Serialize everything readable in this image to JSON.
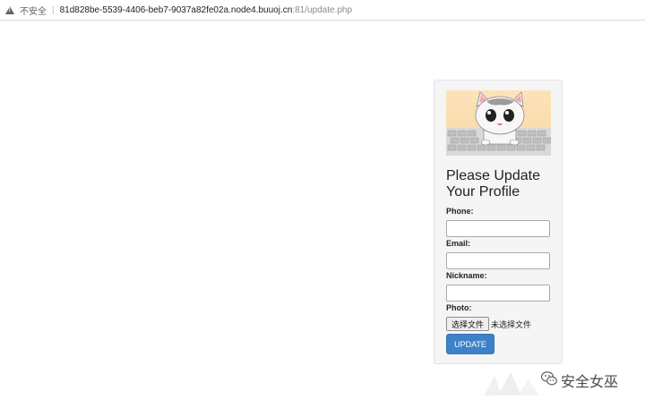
{
  "browser": {
    "security_label": "不安全",
    "url_host": "81d828be-5539-4406-beb7-9037a82fe02a.node4.buuoj.cn",
    "url_path": ":81/update.php"
  },
  "form": {
    "title_line1": "Please Update",
    "title_line2": "Your Profile",
    "phone_label": "Phone:",
    "phone_value": "",
    "email_label": "Email:",
    "email_value": "",
    "nickname_label": "Nickname:",
    "nickname_value": "",
    "photo_label": "Photo:",
    "file_button_label": "选择文件",
    "file_status": "未选择文件",
    "submit_label": "UPDATE"
  },
  "watermark": {
    "text": "安全女巫"
  },
  "icons": {
    "security": "warning-triangle-icon",
    "watermark": "wechat-icon"
  },
  "colors": {
    "primary_button": "#3c82c8",
    "card_background": "#f5f5f5"
  }
}
